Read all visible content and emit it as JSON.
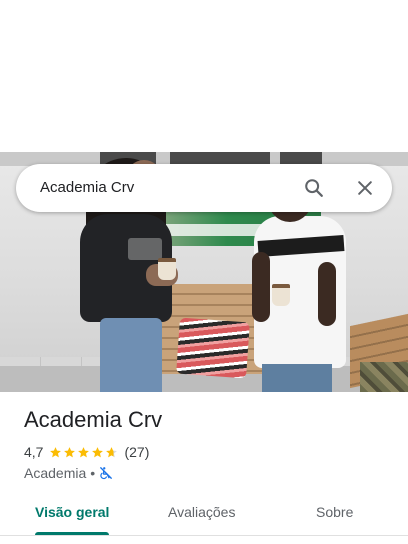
{
  "search": {
    "query": "Academia Crv",
    "search_icon": "search-icon",
    "close_icon": "close-icon"
  },
  "place": {
    "name": "Academia Crv",
    "rating": "4,7",
    "stars": 4.7,
    "review_count": "(27)",
    "category": "Academia",
    "separator": "•",
    "accessibility_icon": "wheelchair-not-accessible-icon"
  },
  "tabs": [
    {
      "label": "Visão geral",
      "active": true
    },
    {
      "label": "Avaliações",
      "active": false
    },
    {
      "label": "Sobre",
      "active": false
    }
  ],
  "colors": {
    "accent": "#00796b",
    "star": "#fbbc04",
    "accessibility_icon": "#1a73e8"
  }
}
